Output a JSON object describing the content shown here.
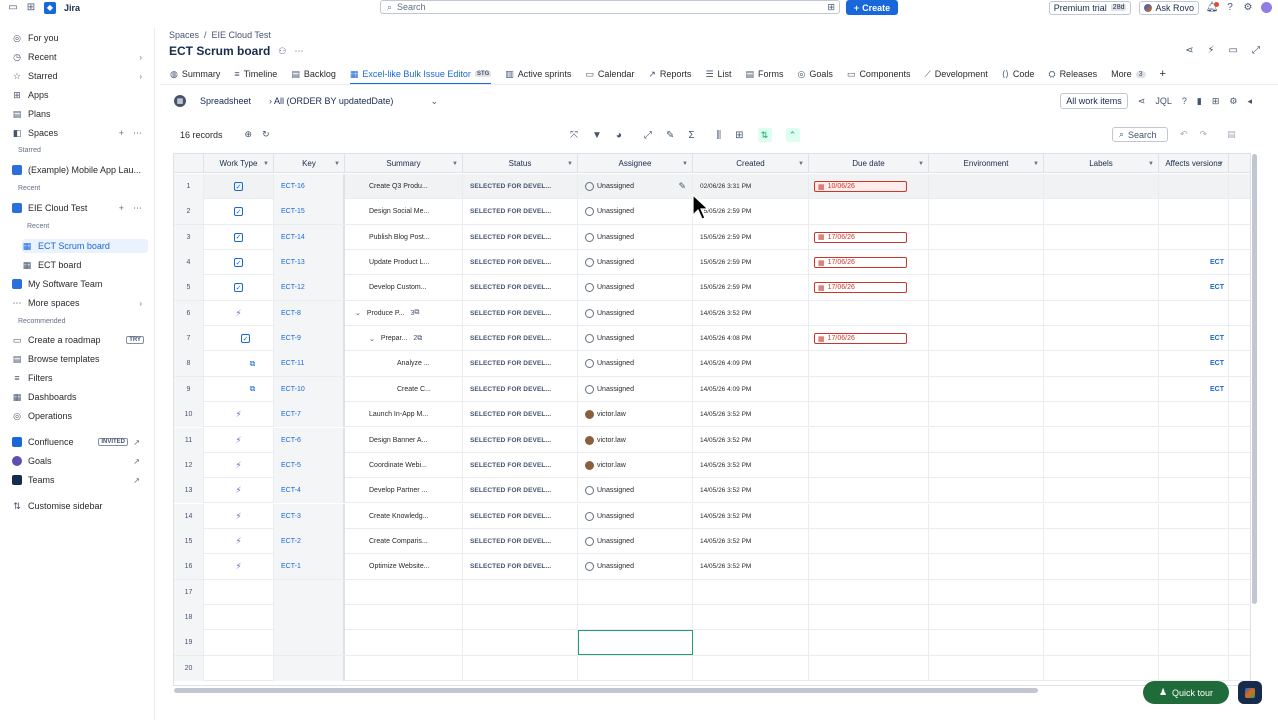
{
  "topbar": {
    "app_name": "Jira",
    "search_placeholder": "Search",
    "create_label": "Create",
    "trial_label": "Premium trial",
    "trial_days": "28d",
    "ask_rovo": "Ask Rovo"
  },
  "sidebar": {
    "for_you": "For you",
    "recent": "Recent",
    "starred": "Starred",
    "apps": "Apps",
    "plans": "Plans",
    "spaces": "Spaces",
    "starred_section": "Starred",
    "starred_project": "(Example) Mobile App Lau...",
    "recent_section": "Recent",
    "eie_cloud_test": "EIE Cloud Test",
    "recent_sub": "Recent",
    "ect_scrum_board": "ECT Scrum board",
    "ect_board": "ECT board",
    "my_software_team": "My Software Team",
    "more_spaces": "More spaces",
    "recommended_section": "Recommended",
    "create_roadmap": "Create a roadmap",
    "try_badge": "TRY",
    "browse_templates": "Browse templates",
    "filters": "Filters",
    "dashboards": "Dashboards",
    "operations": "Operations",
    "confluence": "Confluence",
    "invited_badge": "INVITED",
    "goals": "Goals",
    "teams": "Teams",
    "customise": "Customise sidebar"
  },
  "header": {
    "breadcrumb_spaces": "Spaces",
    "breadcrumb_sep": "/",
    "breadcrumb_project": "EIE Cloud Test",
    "title": "ECT Scrum board"
  },
  "tabs": [
    {
      "label": "Summary",
      "icon": "globe-icon"
    },
    {
      "label": "Timeline",
      "icon": "timeline-icon"
    },
    {
      "label": "Backlog",
      "icon": "backlog-icon"
    },
    {
      "label": "Excel-like Bulk Issue Editor",
      "icon": "editor-icon",
      "badge": "STG",
      "active": true
    },
    {
      "label": "Active sprints",
      "icon": "board-icon"
    },
    {
      "label": "Calendar",
      "icon": "calendar-icon"
    },
    {
      "label": "Reports",
      "icon": "reports-icon"
    },
    {
      "label": "List",
      "icon": "list-icon"
    },
    {
      "label": "Forms",
      "icon": "forms-icon"
    },
    {
      "label": "Goals",
      "icon": "goals-icon"
    },
    {
      "label": "Components",
      "icon": "components-icon"
    },
    {
      "label": "Development",
      "icon": "development-icon"
    },
    {
      "label": "Code",
      "icon": "code-icon"
    },
    {
      "label": "Releases",
      "icon": "releases-icon"
    }
  ],
  "tabs_more": {
    "label": "More",
    "count": "3"
  },
  "toolbar": {
    "spreadsheet": "Spreadsheet",
    "jql_filter": "All (ORDER BY updatedDate)",
    "all_work_items": "All work items",
    "jql": "JQL",
    "records": "16 records",
    "search": "Search"
  },
  "columns": [
    "Work Type",
    "Key",
    "Summary",
    "Status",
    "Assignee",
    "Created",
    "Due date",
    "Environment",
    "Labels",
    "Affects versions"
  ],
  "rows": [
    {
      "num": "1",
      "type": "story",
      "key": "ECT-16",
      "summary": "Create Q3 Produ...",
      "status": "SELECTED FOR DEVEL...",
      "assignee": "Unassigned",
      "avatar": false,
      "created": "02/06/26 3:31 PM",
      "due": "10/06/26",
      "affects": ""
    },
    {
      "num": "2",
      "type": "story",
      "key": "ECT-15",
      "summary": "Design Social Me...",
      "status": "SELECTED FOR DEVEL...",
      "assignee": "Unassigned",
      "avatar": false,
      "created": "15/05/26 2:59 PM",
      "due": "",
      "affects": ""
    },
    {
      "num": "3",
      "type": "story",
      "key": "ECT-14",
      "summary": "Publish Blog Post...",
      "status": "SELECTED FOR DEVEL...",
      "assignee": "Unassigned",
      "avatar": false,
      "created": "15/05/26 2:59 PM",
      "due": "17/06/26",
      "affects": ""
    },
    {
      "num": "4",
      "type": "story",
      "key": "ECT-13",
      "summary": "Update Product L...",
      "status": "SELECTED FOR DEVEL...",
      "assignee": "Unassigned",
      "avatar": false,
      "created": "15/05/26 2:59 PM",
      "due": "17/06/26",
      "affects": "ECT"
    },
    {
      "num": "5",
      "type": "story",
      "key": "ECT-12",
      "summary": "Develop Custom...",
      "status": "SELECTED FOR DEVEL...",
      "assignee": "Unassigned",
      "avatar": false,
      "created": "15/05/26 2:59 PM",
      "due": "17/06/26",
      "affects": "ECT"
    },
    {
      "num": "6",
      "type": "epic",
      "key": "ECT-8",
      "summary": "Produce P...",
      "count": "3",
      "expander": true,
      "status": "SELECTED FOR DEVEL...",
      "assignee": "Unassigned",
      "avatar": false,
      "created": "14/05/26 3:52 PM",
      "due": "",
      "affects": ""
    },
    {
      "num": "7",
      "type": "story",
      "key": "ECT-9",
      "summary": "Prepar...",
      "count": "2",
      "expander": true,
      "indent": 1,
      "status": "SELECTED FOR DEVEL...",
      "assignee": "Unassigned",
      "avatar": false,
      "created": "14/05/26 4:08 PM",
      "due": "17/06/26",
      "affects": "ECT"
    },
    {
      "num": "8",
      "type": "subtask",
      "key": "ECT-11",
      "summary": "Analyze ...",
      "indent": 2,
      "status": "SELECTED FOR DEVEL...",
      "assignee": "Unassigned",
      "avatar": false,
      "created": "14/05/26 4:09 PM",
      "due": "",
      "affects": "ECT"
    },
    {
      "num": "9",
      "type": "subtask",
      "key": "ECT-10",
      "summary": "Create C...",
      "indent": 2,
      "status": "SELECTED FOR DEVEL...",
      "assignee": "Unassigned",
      "avatar": false,
      "created": "14/05/26 4:09 PM",
      "due": "",
      "affects": "ECT"
    },
    {
      "num": "10",
      "type": "epic",
      "key": "ECT-7",
      "summary": "Launch In-App M...",
      "status": "SELECTED FOR DEVEL...",
      "assignee": "victor.law",
      "avatar": true,
      "created": "14/05/26 3:52 PM",
      "due": "",
      "affects": ""
    },
    {
      "num": "11",
      "type": "epic",
      "key": "ECT-6",
      "summary": "Design Banner A...",
      "status": "SELECTED FOR DEVEL...",
      "assignee": "victor.law",
      "avatar": true,
      "created": "14/05/26 3:52 PM",
      "due": "",
      "affects": ""
    },
    {
      "num": "12",
      "type": "epic",
      "key": "ECT-5",
      "summary": "Coordinate Webi...",
      "status": "SELECTED FOR DEVEL...",
      "assignee": "victor.law",
      "avatar": true,
      "created": "14/05/26 3:52 PM",
      "due": "",
      "affects": ""
    },
    {
      "num": "13",
      "type": "epic",
      "key": "ECT-4",
      "summary": "Develop Partner ...",
      "status": "SELECTED FOR DEVEL...",
      "assignee": "Unassigned",
      "avatar": false,
      "created": "14/05/26 3:52 PM",
      "due": "",
      "affects": ""
    },
    {
      "num": "14",
      "type": "epic",
      "key": "ECT-3",
      "summary": "Create Knowledg...",
      "status": "SELECTED FOR DEVEL...",
      "assignee": "Unassigned",
      "avatar": false,
      "created": "14/05/26 3:52 PM",
      "due": "",
      "affects": ""
    },
    {
      "num": "15",
      "type": "epic",
      "key": "ECT-2",
      "summary": "Create Comparis...",
      "status": "SELECTED FOR DEVEL...",
      "assignee": "Unassigned",
      "avatar": false,
      "created": "14/05/26 3:52 PM",
      "due": "",
      "affects": ""
    },
    {
      "num": "16",
      "type": "epic",
      "key": "ECT-1",
      "summary": "Optimize Website...",
      "status": "SELECTED FOR DEVEL...",
      "assignee": "Unassigned",
      "avatar": false,
      "created": "14/05/26 3:52 PM",
      "due": "",
      "affects": ""
    }
  ],
  "empty_rows": [
    "17",
    "18",
    "19",
    "20"
  ],
  "quick_tour": "Quick tour",
  "colors": {
    "accent": "#1868db",
    "due_border": "#c9372c",
    "selection": "#22a06b",
    "quick_tour_bg": "#1f6b3a"
  }
}
